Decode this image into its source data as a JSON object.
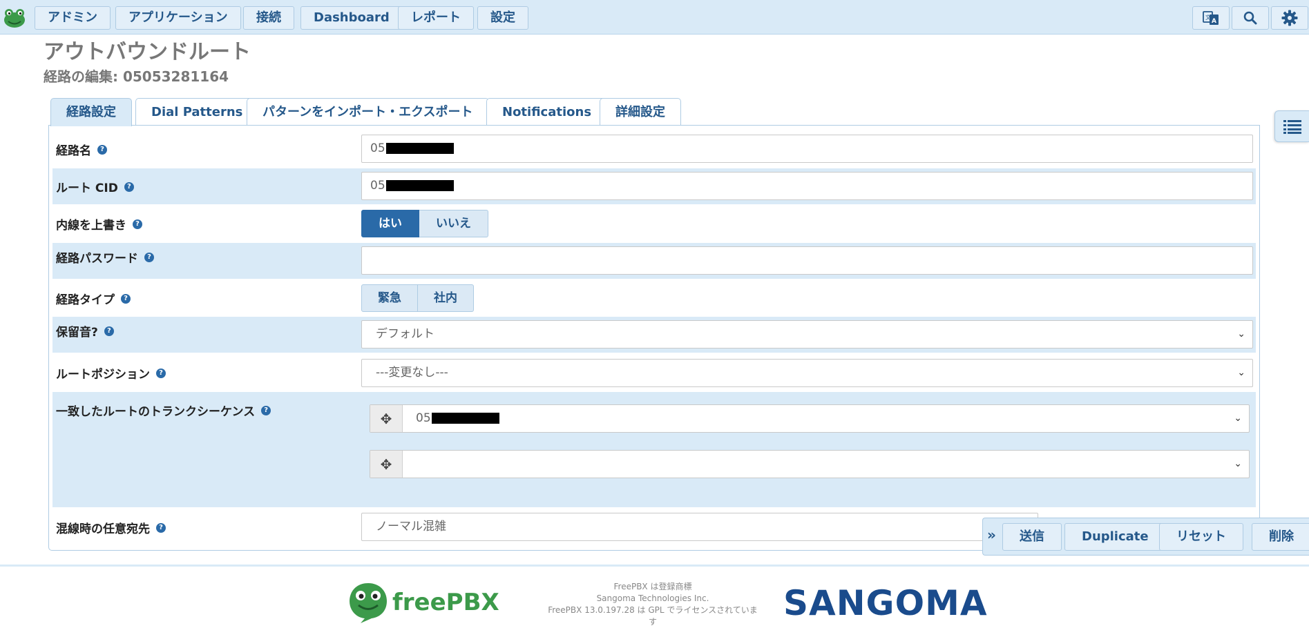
{
  "nav": {
    "items": [
      "アドミン",
      "アプリケーション",
      "接続",
      "Dashboard",
      "レポート",
      "設定"
    ],
    "icons": [
      "language-icon",
      "search-icon",
      "gear-icon"
    ]
  },
  "page": {
    "title": "アウトバウンドルート",
    "subtitle": "経路の編集: 05053281164"
  },
  "tabs": [
    "経路設定",
    "Dial Patterns",
    "パターンをインポート・エクスポート",
    "Notifications",
    "詳細設定"
  ],
  "form": {
    "route_name": {
      "label": "経路名",
      "value": "05"
    },
    "route_cid": {
      "label": "ルート CID",
      "value": "05"
    },
    "override_ext": {
      "label": "内線を上書き",
      "options": [
        "はい",
        "いいえ"
      ],
      "selected": "はい"
    },
    "route_password": {
      "label": "経路パスワード",
      "value": ""
    },
    "route_type": {
      "label": "経路タイプ",
      "options": [
        "緊急",
        "社内"
      ]
    },
    "music_on_hold": {
      "label": "保留音?",
      "value": "デフォルト"
    },
    "route_position": {
      "label": "ルートポジション",
      "value": "---変更なし---"
    },
    "trunk_sequence": {
      "label": "一致したルートのトランクシーケンス",
      "trunks": [
        "05",
        ""
      ]
    },
    "congestion_dest": {
      "label": "混線時の任意宛先",
      "value": "ノーマル混雑"
    }
  },
  "actions": [
    "送信",
    "Duplicate",
    "リセット",
    "削除"
  ],
  "footer": {
    "logo_left": "freePBX",
    "logo_right": "SANGOMA",
    "lines": [
      "FreePBX は登録商標",
      "Sangoma Technologies Inc.",
      "FreePBX 13.0.197.28 は GPL でライセンスされていま",
      "す"
    ]
  },
  "colors": {
    "accent": "#2a6aa8",
    "nav_bg": "#d9eaf7",
    "text_link": "#25588a"
  }
}
